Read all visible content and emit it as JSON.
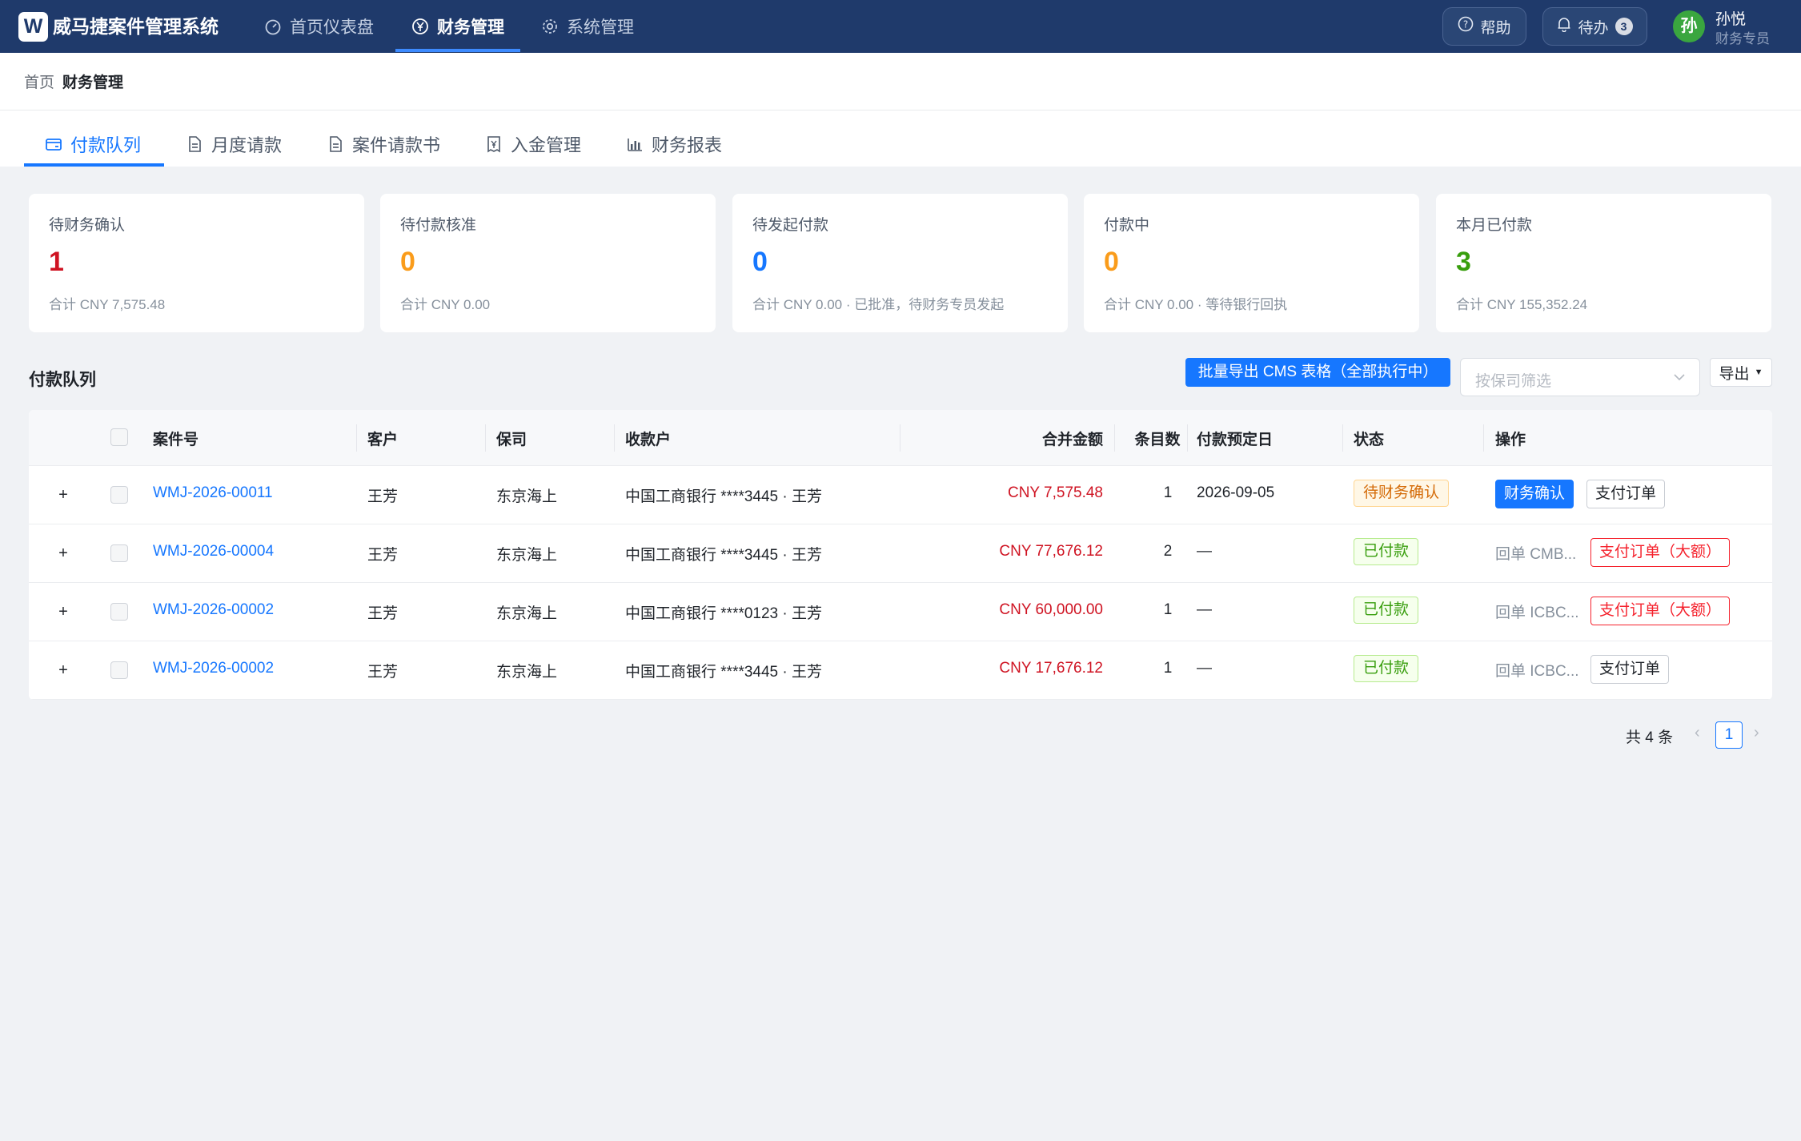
{
  "app": {
    "logo_letter": "W",
    "title": "威马捷案件管理系统"
  },
  "nav": {
    "items": [
      {
        "label": "首页仪表盘",
        "icon": "dashboard-icon"
      },
      {
        "label": "财务管理",
        "icon": "finance-icon",
        "active": true
      },
      {
        "label": "系统管理",
        "icon": "gear-icon"
      }
    ]
  },
  "header_actions": {
    "help_label": "帮助",
    "todo_label": "待办",
    "todo_count": "3"
  },
  "user": {
    "avatar_char": "孙",
    "name": "孙悦",
    "role": "财务专员"
  },
  "breadcrumb": [
    "首页",
    "财务管理"
  ],
  "tabs": [
    {
      "label": "付款队列",
      "icon": "wallet-icon",
      "active": true
    },
    {
      "label": "月度请款",
      "icon": "document-icon"
    },
    {
      "label": "案件请款书",
      "icon": "document-icon"
    },
    {
      "label": "入金管理",
      "icon": "receipt-icon"
    },
    {
      "label": "财务报表",
      "icon": "bar-chart-icon"
    }
  ],
  "stats": [
    {
      "label": "待财务确认",
      "value": "1",
      "sub": "合计 CNY 7,575.48",
      "color": "#cf1322"
    },
    {
      "label": "待付款核准",
      "value": "0",
      "sub": "合计 CNY 0.00",
      "color": "#fa9c1b"
    },
    {
      "label": "待发起付款",
      "value": "0",
      "sub": "合计 CNY 0.00 · 已批准，待财务专员发起",
      "color": "#1677ff"
    },
    {
      "label": "付款中",
      "value": "0",
      "sub": "合计 CNY 0.00 · 等待银行回执",
      "color": "#fa9c1b"
    },
    {
      "label": "本月已付款",
      "value": "3",
      "sub": "合计 CNY 155,352.24",
      "color": "#389e0d"
    }
  ],
  "queue": {
    "title": "付款队列",
    "batch_export_label": "批量导出 CMS 表格（全部执行中）",
    "insurer_filter_placeholder": "按保司筛选",
    "export_label": "导出"
  },
  "table": {
    "columns": [
      "案件号",
      "客户",
      "保司",
      "收款户",
      "合并金额",
      "条目数",
      "付款预定日",
      "状态",
      "操作"
    ],
    "rows": [
      {
        "case_no": "WMJ-2026-00011",
        "client": "王芳",
        "insurer": "东京海上",
        "payee": "中国工商银行 ****3445 · 王芳",
        "amount": "CNY 7,575.48",
        "items": "1",
        "due_date": "2026-09-05",
        "status": "待财务确认",
        "status_type": "pending",
        "receipt": "",
        "action_primary": "财务确认",
        "action_secondary": "支付订单",
        "secondary_type": "default"
      },
      {
        "case_no": "WMJ-2026-00004",
        "client": "王芳",
        "insurer": "东京海上",
        "payee": "中国工商银行 ****3445 · 王芳",
        "amount": "CNY 77,676.12",
        "items": "2",
        "due_date": "—",
        "status": "已付款",
        "status_type": "paid",
        "receipt": "回单 CMB...",
        "action_primary": "",
        "action_secondary": "支付订单（大额）",
        "secondary_type": "danger"
      },
      {
        "case_no": "WMJ-2026-00002",
        "client": "王芳",
        "insurer": "东京海上",
        "payee": "中国工商银行 ****0123 · 王芳",
        "amount": "CNY 60,000.00",
        "items": "1",
        "due_date": "—",
        "status": "已付款",
        "status_type": "paid",
        "receipt": "回单 ICBC...",
        "action_primary": "",
        "action_secondary": "支付订单（大额）",
        "secondary_type": "danger"
      },
      {
        "case_no": "WMJ-2026-00002",
        "client": "王芳",
        "insurer": "东京海上",
        "payee": "中国工商银行 ****3445 · 王芳",
        "amount": "CNY 17,676.12",
        "items": "1",
        "due_date": "—",
        "status": "已付款",
        "status_type": "paid",
        "receipt": "回单 ICBC...",
        "action_primary": "",
        "action_secondary": "支付订单",
        "secondary_type": "default"
      }
    ]
  },
  "pagination": {
    "total_label": "共 4 条",
    "current_page": "1",
    "prev_icon": "chevron-left-icon",
    "next_icon": "chevron-right-icon"
  }
}
